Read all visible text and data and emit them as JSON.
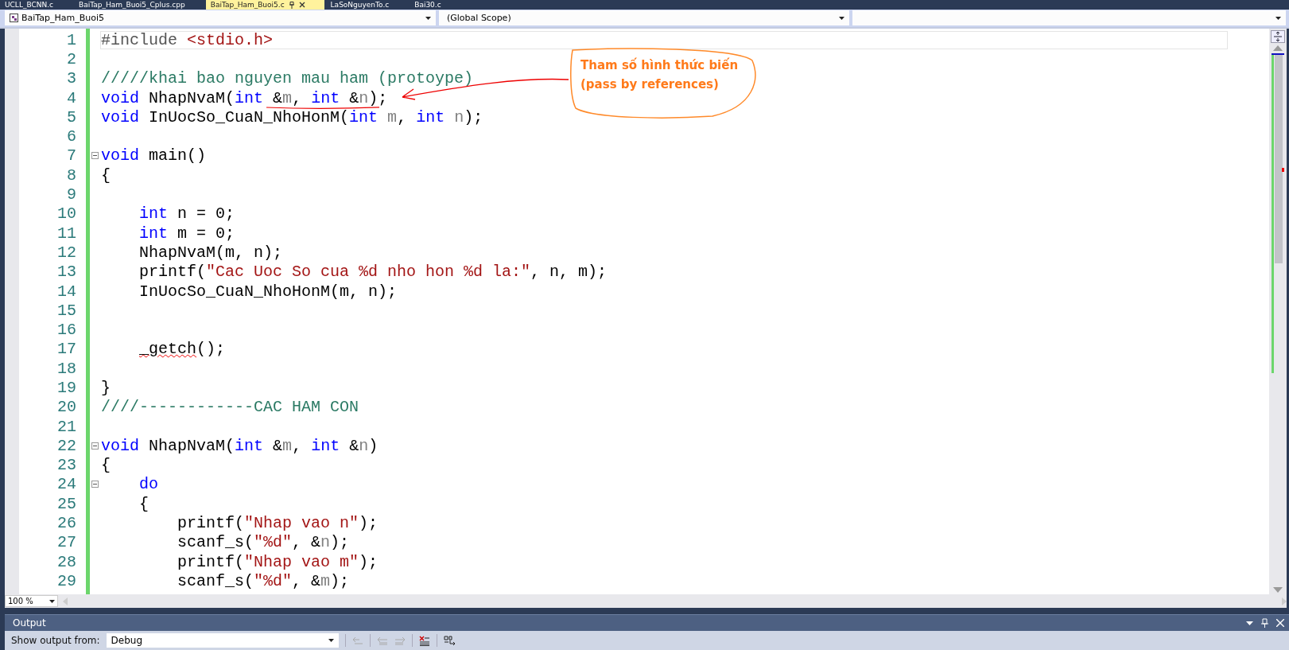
{
  "tabs": [
    {
      "label": "UCLL_BCNN.c",
      "selected": false
    },
    {
      "label": "BaiTap_Ham_Buoi5_Cplus.cpp",
      "selected": false
    },
    {
      "label": "BaiTap_Ham_Buoi5.c",
      "selected": true
    },
    {
      "label": "LaSoNguyenTo.c",
      "selected": false
    },
    {
      "label": "Bai30.c",
      "selected": false
    }
  ],
  "navigation": {
    "project": "BaiTap_Ham_Buoi5",
    "scope": "(Global Scope)"
  },
  "editor": {
    "zoom": "100 %",
    "lines": [
      {
        "number": "1",
        "fold": false,
        "tokens": [
          {
            "kind": "directive",
            "text": "#include "
          },
          {
            "kind": "string",
            "text": "<stdio.h>"
          }
        ]
      },
      {
        "number": "2",
        "fold": false
      },
      {
        "number": "3",
        "fold": false,
        "tokens": [
          {
            "kind": "comment",
            "text": "/////khai bao nguyen mau ham (protoype)"
          }
        ]
      },
      {
        "number": "4",
        "fold": false,
        "tokens": [
          {
            "kind": "keyword",
            "text": "void"
          },
          {
            "kind": "plain",
            "text": " NhapNvaM("
          },
          {
            "kind": "keyword",
            "text": "int"
          },
          {
            "kind": "plain",
            "text": " &"
          },
          {
            "kind": "param",
            "text": "m"
          },
          {
            "kind": "plain",
            "text": ", "
          },
          {
            "kind": "keyword",
            "text": "int"
          },
          {
            "kind": "plain",
            "text": " &"
          },
          {
            "kind": "param",
            "text": "n"
          },
          {
            "kind": "plain",
            "text": ");"
          }
        ]
      },
      {
        "number": "5",
        "fold": false,
        "tokens": [
          {
            "kind": "keyword",
            "text": "void"
          },
          {
            "kind": "plain",
            "text": " InUocSo_CuaN_NhoHonM("
          },
          {
            "kind": "keyword",
            "text": "int"
          },
          {
            "kind": "param",
            "text": " m"
          },
          {
            "kind": "plain",
            "text": ", "
          },
          {
            "kind": "keyword",
            "text": "int"
          },
          {
            "kind": "param",
            "text": " n"
          },
          {
            "kind": "plain",
            "text": ");"
          }
        ]
      },
      {
        "number": "6",
        "fold": false
      },
      {
        "number": "7",
        "fold": true,
        "tokens": [
          {
            "kind": "keyword",
            "text": "void"
          },
          {
            "kind": "plain",
            "text": " main()"
          }
        ]
      },
      {
        "number": "8",
        "fold": false,
        "tokens": [
          {
            "kind": "plain",
            "text": "{"
          }
        ]
      },
      {
        "number": "9",
        "fold": false
      },
      {
        "number": "10",
        "fold": false,
        "tokens": [
          {
            "kind": "keyword",
            "text": "    int"
          },
          {
            "kind": "plain",
            "text": " n = 0;"
          }
        ]
      },
      {
        "number": "11",
        "fold": false,
        "tokens": [
          {
            "kind": "keyword",
            "text": "    int"
          },
          {
            "kind": "plain",
            "text": " m = 0;"
          }
        ]
      },
      {
        "number": "12",
        "fold": false,
        "tokens": [
          {
            "kind": "plain",
            "text": "    NhapNvaM(m, n);"
          }
        ]
      },
      {
        "number": "13",
        "fold": false,
        "tokens": [
          {
            "kind": "plain",
            "text": "    printf("
          },
          {
            "kind": "string",
            "text": "\"Cac Uoc So cua %d nho hon %d la:\""
          },
          {
            "kind": "plain",
            "text": ", n, m);"
          }
        ]
      },
      {
        "number": "14",
        "fold": false,
        "tokens": [
          {
            "kind": "plain",
            "text": "    InUocSo_CuaN_NhoHonM(m, n);"
          }
        ]
      },
      {
        "number": "15",
        "fold": false
      },
      {
        "number": "16",
        "fold": false
      },
      {
        "number": "17",
        "fold": false,
        "tokens": [
          {
            "kind": "error",
            "text": "    _getch"
          },
          {
            "kind": "plain",
            "text": "();"
          }
        ]
      },
      {
        "number": "18",
        "fold": false
      },
      {
        "number": "19",
        "fold": false,
        "tokens": [
          {
            "kind": "plain",
            "text": "}"
          }
        ]
      },
      {
        "number": "20",
        "fold": false,
        "tokens": [
          {
            "kind": "comment",
            "text": "////------------CAC HAM CON"
          }
        ]
      },
      {
        "number": "21",
        "fold": false
      },
      {
        "number": "22",
        "fold": true,
        "tokens": [
          {
            "kind": "keyword",
            "text": "void"
          },
          {
            "kind": "plain",
            "text": " NhapNvaM("
          },
          {
            "kind": "keyword",
            "text": "int"
          },
          {
            "kind": "plain",
            "text": " &"
          },
          {
            "kind": "param",
            "text": "m"
          },
          {
            "kind": "plain",
            "text": ", "
          },
          {
            "kind": "keyword",
            "text": "int"
          },
          {
            "kind": "plain",
            "text": " &"
          },
          {
            "kind": "param",
            "text": "n"
          },
          {
            "kind": "plain",
            "text": ")"
          }
        ]
      },
      {
        "number": "23",
        "fold": false,
        "tokens": [
          {
            "kind": "plain",
            "text": "{"
          }
        ]
      },
      {
        "number": "24",
        "fold": true,
        "tokens": [
          {
            "kind": "keyword",
            "text": "    do"
          }
        ]
      },
      {
        "number": "25",
        "fold": false,
        "tokens": [
          {
            "kind": "plain",
            "text": "    {"
          }
        ]
      },
      {
        "number": "26",
        "fold": false,
        "tokens": [
          {
            "kind": "plain",
            "text": "        printf("
          },
          {
            "kind": "string",
            "text": "\"Nhap vao n\""
          },
          {
            "kind": "plain",
            "text": ");"
          }
        ]
      },
      {
        "number": "27",
        "fold": false,
        "tokens": [
          {
            "kind": "plain",
            "text": "        scanf_s("
          },
          {
            "kind": "string",
            "text": "\"%d\""
          },
          {
            "kind": "plain",
            "text": ", &"
          },
          {
            "kind": "param",
            "text": "n"
          },
          {
            "kind": "plain",
            "text": ");"
          }
        ]
      },
      {
        "number": "28",
        "fold": false,
        "tokens": [
          {
            "kind": "plain",
            "text": "        printf("
          },
          {
            "kind": "string",
            "text": "\"Nhap vao m\""
          },
          {
            "kind": "plain",
            "text": ");"
          }
        ]
      },
      {
        "number": "29",
        "fold": false,
        "tokens": [
          {
            "kind": "plain",
            "text": "        scanf_s("
          },
          {
            "kind": "string",
            "text": "\"%d\""
          },
          {
            "kind": "plain",
            "text": ", &"
          },
          {
            "kind": "param",
            "text": "m"
          },
          {
            "kind": "plain",
            "text": ");"
          }
        ]
      }
    ]
  },
  "annotation": {
    "lines": [
      "Tham số hình thức biến",
      "(pass by references)"
    ]
  },
  "output_panel": {
    "title": "Output",
    "source_label": "Show output from:",
    "source": "Debug"
  }
}
